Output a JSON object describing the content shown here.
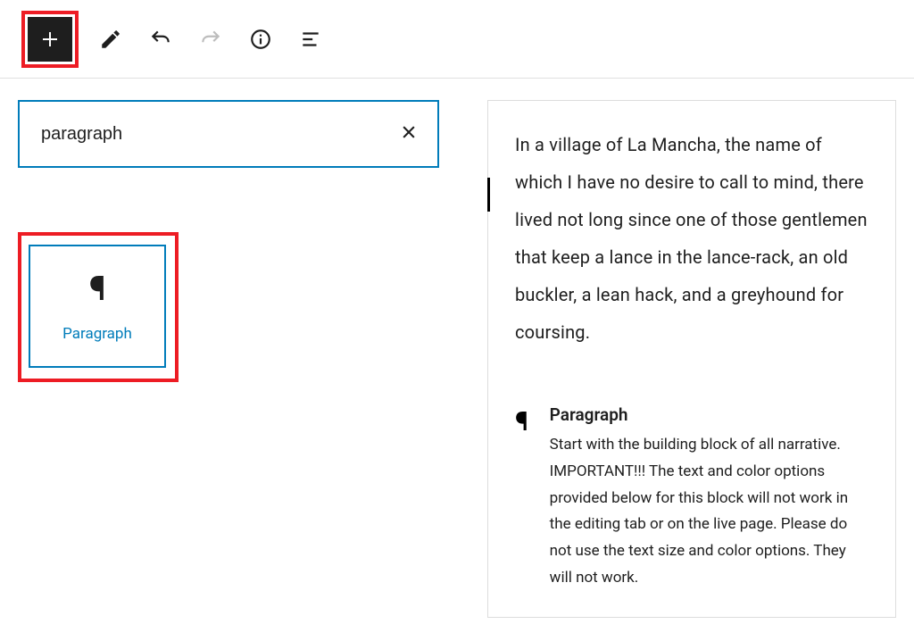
{
  "toolbar": {
    "add_label": "Add block"
  },
  "search": {
    "value": "paragraph"
  },
  "result": {
    "label": "Paragraph"
  },
  "preview": {
    "sample": "In a village of La Mancha, the name of which I have no desire to call to mind, there lived not long since one of those gentlemen that keep a lance in the lance-rack, an old buckler, a lean hack, and a greyhound for coursing.",
    "info_title": "Paragraph",
    "info_desc": "Start with the building block of all narrative. IMPORTANT!!! The text and color options provided below for this block will not work in the editing tab or on the live page. Please do not use the text size and color options. They will not work."
  },
  "colors": {
    "accent": "#007cba",
    "highlight": "#ed1c24"
  }
}
